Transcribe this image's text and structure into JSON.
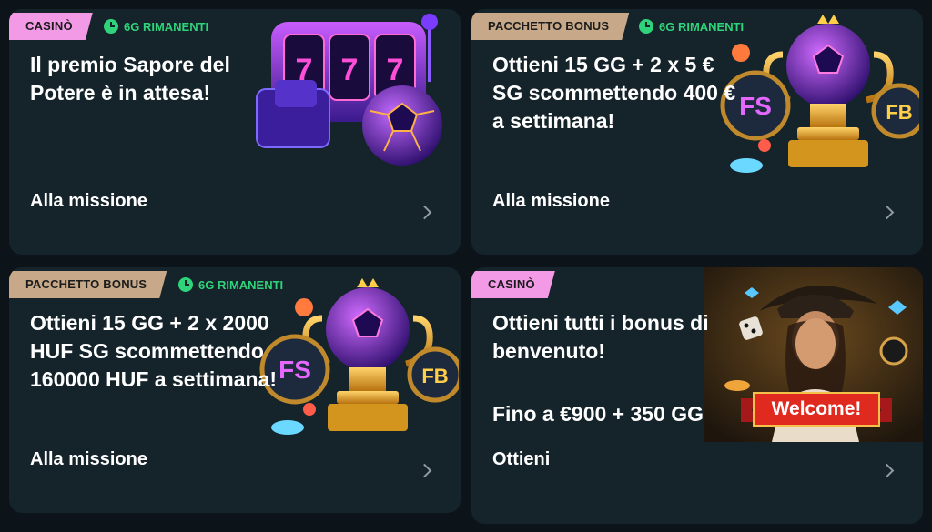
{
  "cards": [
    {
      "tag": "CASINÒ",
      "remaining": "6G RIMANENTI",
      "title": "Il premio Sapore del Potere è in attesa!",
      "cta": "Alla missione",
      "image": "slot-machine-wallet-ball-icon"
    },
    {
      "tag": "PACCHETTO BONUS",
      "remaining": "6G RIMANENTI",
      "title": "Ottieni 15 GG + 2 x 5 € SG scommettendo 400 € a settimana!",
      "cta": "Alla missione",
      "image": "trophy-ball-coins-icon"
    },
    {
      "tag": "PACCHETTO BONUS",
      "remaining": "6G RIMANENTI",
      "title": "Ottieni 15 GG + 2 x 2000 HUF SG scommettendo 160000 HUF a settimana!",
      "cta": "Alla missione",
      "image": "trophy-ball-coins-icon"
    },
    {
      "tag": "CASINÒ",
      "title": "Ottieni tutti i bonus di benvenuto!",
      "subtitle": "Fino a €900 + 350 GG",
      "cta": "Ottieni",
      "banner": "Welcome!",
      "image": "pirate-woman-welcome-icon"
    }
  ],
  "colors": {
    "background": "#0d1419",
    "card": "#15232b",
    "casino_tag": "#f29ae6",
    "bonus_tag": "#c7a98a",
    "remaining": "#2fd47a"
  }
}
